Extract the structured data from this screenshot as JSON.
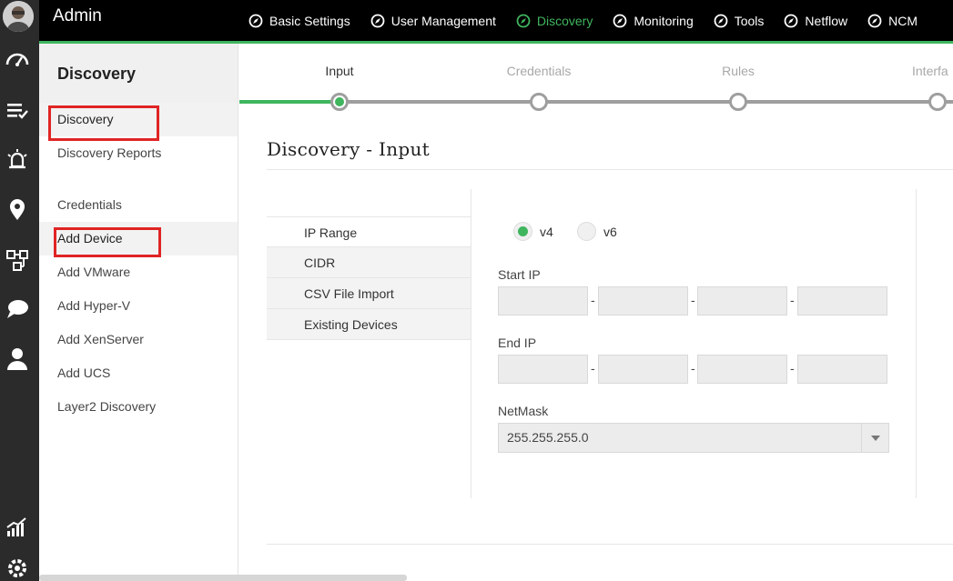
{
  "header": {
    "title": "Admin",
    "nav": [
      {
        "label": "Basic Settings",
        "active": false
      },
      {
        "label": "User Management",
        "active": false
      },
      {
        "label": "Discovery",
        "active": true
      },
      {
        "label": "Monitoring",
        "active": false
      },
      {
        "label": "Tools",
        "active": false
      },
      {
        "label": "Netflow",
        "active": false
      },
      {
        "label": "NCM",
        "active": false
      }
    ]
  },
  "rail": {
    "icons": [
      "avatar",
      "dashboard-icon",
      "inventory-icon",
      "alarms-icon",
      "location-icon",
      "workflow-icon",
      "chat-icon",
      "user-icon",
      "reports-icon",
      "settings-icon"
    ]
  },
  "sidebar": {
    "title": "Discovery",
    "items": [
      {
        "label": "Discovery",
        "selected": true,
        "highlighted": true
      },
      {
        "label": "Discovery Reports"
      },
      {
        "label": "Credentials"
      },
      {
        "label": "Add Device",
        "selected": true,
        "highlighted": true
      },
      {
        "label": "Add VMware"
      },
      {
        "label": "Add Hyper-V"
      },
      {
        "label": "Add XenServer"
      },
      {
        "label": "Add UCS"
      },
      {
        "label": "Layer2 Discovery"
      }
    ]
  },
  "wizard": {
    "steps": [
      {
        "label": "Input",
        "active": true
      },
      {
        "label": "Credentials",
        "active": false
      },
      {
        "label": "Rules",
        "active": false
      },
      {
        "label": "Interfa",
        "active": false
      }
    ]
  },
  "main": {
    "title": "Discovery - Input",
    "input_types": [
      "IP Range",
      "CIDR",
      "CSV File Import",
      "Existing Devices"
    ],
    "selected_input_type": "IP Range",
    "ip_version": {
      "options": [
        "v4",
        "v6"
      ],
      "selected": "v4"
    },
    "start_ip_label": "Start IP",
    "start_ip_values": [
      "",
      "",
      "",
      ""
    ],
    "end_ip_label": "End IP",
    "end_ip_values": [
      "",
      "",
      "",
      ""
    ],
    "separator": "-",
    "netmask_label": "NetMask",
    "netmask_value": "255.255.255.0"
  },
  "colors": {
    "accent": "#3fb55e",
    "header_bg": "#000000",
    "rail_bg": "#2b2b2b",
    "highlight": "#e02424"
  }
}
